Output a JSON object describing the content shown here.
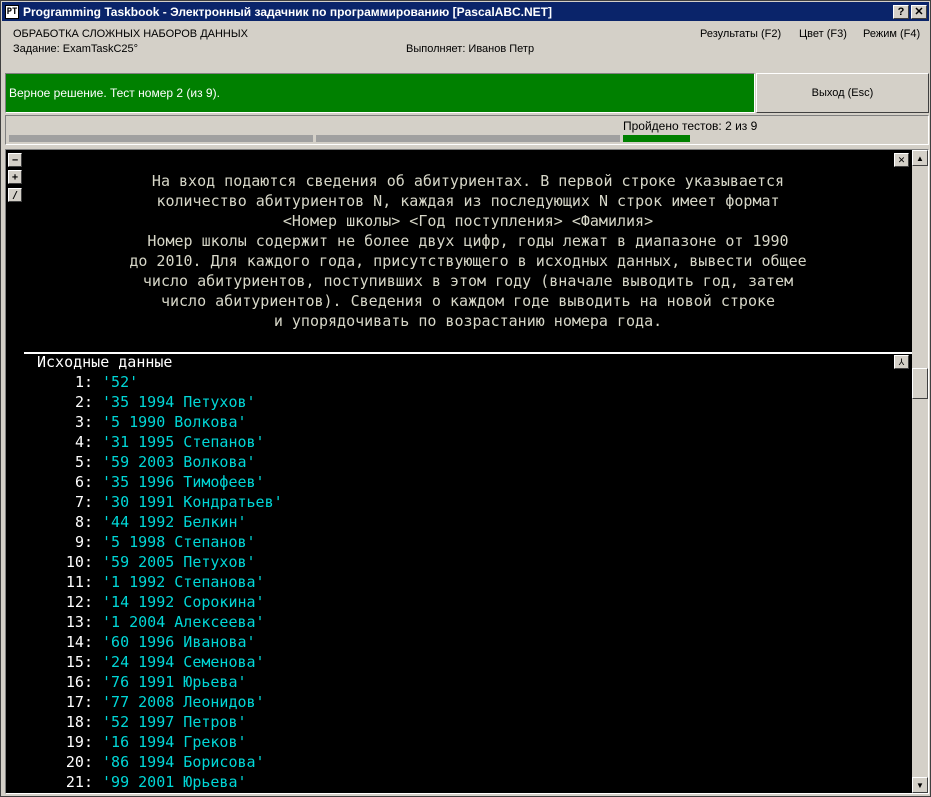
{
  "window": {
    "title": "Programming Taskbook - Электронный задачник по программированию [PascalABC.NET]",
    "help_btn": "?",
    "close_btn": "✕"
  },
  "header": {
    "section_title": "ОБРАБОТКА СЛОЖНЫХ НАБОРОВ ДАННЫХ",
    "task": "Задание: ExamTaskC25°",
    "author": "Выполняет: Иванов Петр",
    "menu": {
      "results": "Результаты (F2)",
      "color": "Цвет (F3)",
      "mode": "Режим (F4)"
    }
  },
  "status": {
    "message": "Верное решение. Тест номер 2 (из 9).",
    "exit_label": "Выход (Esc)",
    "colors": {
      "success": "#008000"
    }
  },
  "progress": {
    "passed_text": "Пройдено тестов: 2 из 9",
    "passed": 2,
    "total": 9
  },
  "side_buttons": [
    "−",
    "+",
    "/"
  ],
  "description": [
    "На вход подаются сведения об абитуриентах. В первой строке указывается",
    "количество абитуриентов N, каждая из последующих N строк имеет формат",
    "<Номер школы> <Год поступления> <Фамилия>",
    "Номер школы содержит не более двух цифр, годы лежат в диапазоне от 1990",
    "до 2010. Для каждого года, присутствующего в исходных данных, вывести общее",
    "число абитуриентов, поступивших в этом году (вначале выводить год, затем",
    "число абитуриентов). Сведения о каждом годе выводить на новой строке",
    "и упорядочивать по возрастанию номера года."
  ],
  "input": {
    "title": "Исходные данные",
    "lines": [
      {
        "num": "1:",
        "val": "'52'"
      },
      {
        "num": "2:",
        "val": "'35 1994 Петухов'"
      },
      {
        "num": "3:",
        "val": "'5 1990 Волкова'"
      },
      {
        "num": "4:",
        "val": "'31 1995 Степанов'"
      },
      {
        "num": "5:",
        "val": "'59 2003 Волкова'"
      },
      {
        "num": "6:",
        "val": "'35 1996 Тимофеев'"
      },
      {
        "num": "7:",
        "val": "'30 1991 Кондратьев'"
      },
      {
        "num": "8:",
        "val": "'44 1992 Белкин'"
      },
      {
        "num": "9:",
        "val": "'5 1998 Степанов'"
      },
      {
        "num": "10:",
        "val": "'59 2005 Петухов'"
      },
      {
        "num": "11:",
        "val": "'1 1992 Степанова'"
      },
      {
        "num": "12:",
        "val": "'14 1992 Сорокина'"
      },
      {
        "num": "13:",
        "val": "'1 2004 Алексеева'"
      },
      {
        "num": "14:",
        "val": "'60 1996 Иванова'"
      },
      {
        "num": "15:",
        "val": "'24 1994 Семенова'"
      },
      {
        "num": "16:",
        "val": "'76 1991 Юрьева'"
      },
      {
        "num": "17:",
        "val": "'77 2008 Леонидов'"
      },
      {
        "num": "18:",
        "val": "'52 1997 Петров'"
      },
      {
        "num": "19:",
        "val": "'16 1994 Греков'"
      },
      {
        "num": "20:",
        "val": "'86 1994 Борисова'"
      },
      {
        "num": "21:",
        "val": "'99 2001 Юрьева'"
      }
    ]
  }
}
